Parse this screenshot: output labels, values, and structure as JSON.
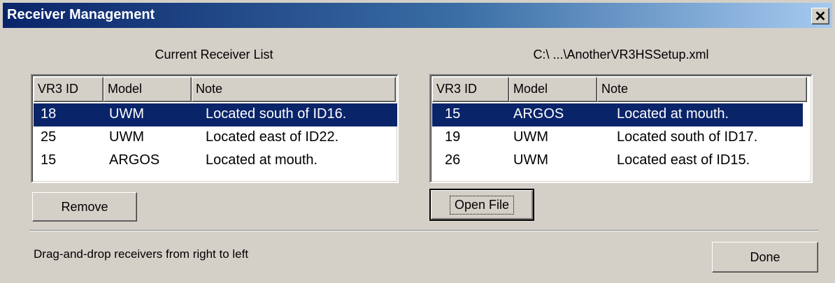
{
  "window": {
    "title": "Receiver Management",
    "close_glyph": "✕"
  },
  "left": {
    "caption": "Current Receiver List",
    "columns": [
      "VR3 ID",
      "Model",
      "Note"
    ],
    "rows": [
      {
        "id": "18",
        "model": "UWM",
        "note": "Located south of ID16.",
        "selected": true
      },
      {
        "id": "25",
        "model": "UWM",
        "note": "Located east of ID22.",
        "selected": false
      },
      {
        "id": "15",
        "model": "ARGOS",
        "note": "Located at mouth.",
        "selected": false
      }
    ],
    "button": "Remove"
  },
  "right": {
    "caption": "C:\\ ...\\AnotherVR3HSSetup.xml",
    "columns": [
      "VR3 ID",
      "Model",
      "Note"
    ],
    "rows": [
      {
        "id": "15",
        "model": "ARGOS",
        "note": "Located at mouth.",
        "selected": true
      },
      {
        "id": "19",
        "model": "UWM",
        "note": "Located south of ID17.",
        "selected": false
      },
      {
        "id": "26",
        "model": "UWM",
        "note": "Located east of ID15.",
        "selected": false
      }
    ],
    "button": "Open File"
  },
  "footer": {
    "status": "Drag-and-drop receivers from right to left",
    "done": "Done"
  },
  "colors": {
    "face": "#d4d0c8",
    "selection": "#0a246a",
    "title_start": "#0a246a",
    "title_end": "#a6caf0"
  }
}
